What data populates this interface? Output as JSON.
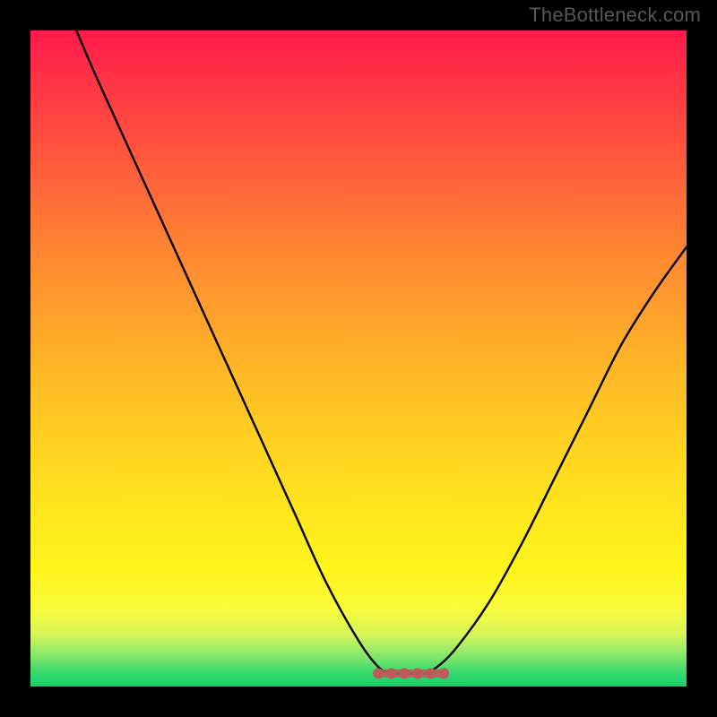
{
  "watermark": "TheBottleneck.com",
  "chart_data": {
    "type": "line",
    "title": "",
    "xlabel": "",
    "ylabel": "",
    "xlim": [
      0,
      100
    ],
    "ylim": [
      0,
      100
    ],
    "series": [
      {
        "name": "curve",
        "x": [
          7,
          10,
          15,
          20,
          25,
          30,
          35,
          40,
          45,
          50,
          53,
          55,
          57,
          60,
          62,
          65,
          70,
          75,
          80,
          85,
          90,
          95,
          100
        ],
        "values": [
          100,
          93,
          82,
          71,
          60,
          49,
          38,
          27,
          16,
          7,
          3,
          2,
          2,
          2,
          3,
          6,
          13,
          22,
          32,
          42,
          52,
          60,
          67
        ]
      },
      {
        "name": "bottom-markers",
        "x": [
          53,
          55,
          57,
          59,
          61,
          63
        ],
        "values": [
          2,
          2,
          2,
          2,
          2,
          2
        ]
      }
    ],
    "colors": {
      "curve_stroke": "#000000",
      "marker_fill": "#c05a5a",
      "gradient_top": "#ff1a4b",
      "gradient_mid": "#ffe41e",
      "gradient_bottom": "#17cf66",
      "background": "#000000",
      "watermark": "#555759"
    }
  }
}
